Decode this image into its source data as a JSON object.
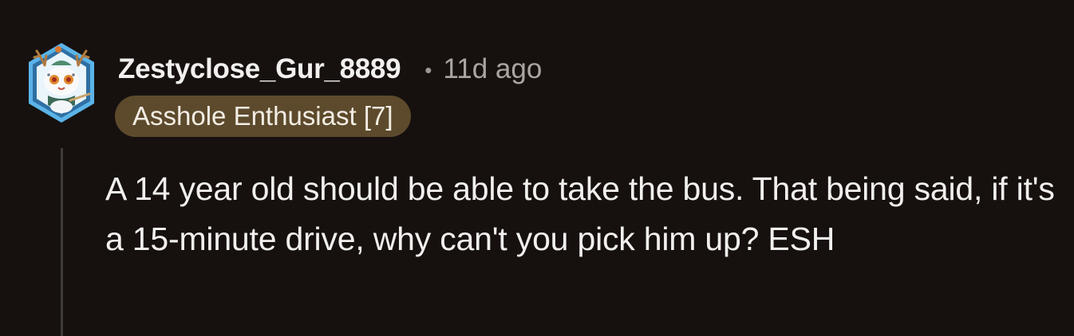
{
  "comment": {
    "author": "Zestyclose_Gur_8889",
    "separator": "•",
    "timestamp": "11d ago",
    "flair": "Asshole Enthusiast [7]",
    "body": "A 14 year old should be able to take the bus. That being said, if it's a 15-minute drive, why can't you pick him up? ESH"
  },
  "colors": {
    "background": "#16110f",
    "text": "#f2f0ee",
    "meta": "#aaa5a0",
    "flair_bg": "#5d4a2c",
    "thread_line": "#3f3b38",
    "avatar_border": "#5bb4e8"
  },
  "icons": {
    "avatar": "snow-leopard-with-antlers-avatar"
  }
}
